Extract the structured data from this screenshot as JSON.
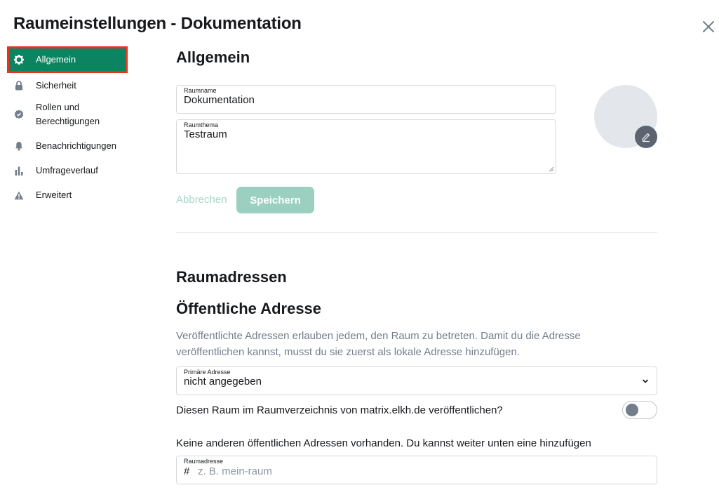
{
  "dialog": {
    "title": "Raumeinstellungen - Dokumentation"
  },
  "sidebar": {
    "items": [
      {
        "label": "Allgemein",
        "icon": "gear-icon",
        "active": true
      },
      {
        "label": "Sicherheit",
        "icon": "lock-icon"
      },
      {
        "label": "Rollen und Berechtigungen",
        "icon": "badge-check-icon"
      },
      {
        "label": "Benachrichtigungen",
        "icon": "bell-icon"
      },
      {
        "label": "Umfrageverlauf",
        "icon": "bar-chart-icon"
      },
      {
        "label": "Erweitert",
        "icon": "warning-icon"
      }
    ]
  },
  "general": {
    "heading": "Allgemein",
    "room_name_label": "Raumname",
    "room_name_value": "Dokumentation",
    "room_topic_label": "Raumthema",
    "room_topic_value": "Testraum",
    "cancel_label": "Abbrechen",
    "save_label": "Speichern"
  },
  "addresses": {
    "heading": "Raumadressen",
    "public_heading": "Öffentliche Adresse",
    "description": "Veröffentlichte Adressen erlauben jedem, den Raum zu betreten. Damit du die Adresse veröffentlichen kannst, musst du sie zuerst als lokale Adresse hinzufügen.",
    "primary_label": "Primäre Adresse",
    "primary_value": "nicht angegeben",
    "publish_text": "Diesen Raum im Raumverzeichnis von matrix.elkh.de veröffentlichen?",
    "publish_enabled": false,
    "no_other_text": "Keine anderen öffentlichen Adressen vorhanden. Du kannst weiter unten eine hinzufügen",
    "address_label": "Raumadresse",
    "address_prefix": "#",
    "address_placeholder": "z. B. mein-raum"
  },
  "colors": {
    "accent": "#0d8461",
    "highlight_border": "#e8341c",
    "save_disabled": "#9bcfbf",
    "cancel_disabled": "#a9d6c8"
  }
}
